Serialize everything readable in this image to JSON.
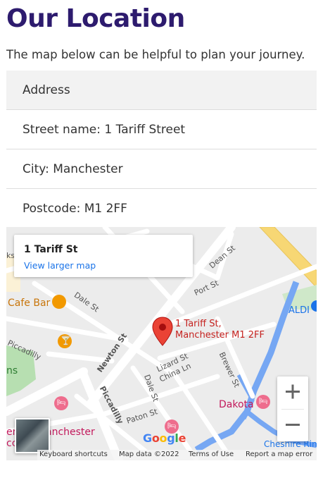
{
  "title": "Our Location",
  "intro": "The map below can be helpful to plan your journey.",
  "address_table": {
    "header": "Address",
    "rows": [
      "Street name: 1 Tariff Street",
      "City: Manchester",
      "Postcode: M1 2FF"
    ]
  },
  "map": {
    "card": {
      "place": "1 Tariff St",
      "link": "View larger map"
    },
    "pin_label_line1": "1 Tariff St,",
    "pin_label_line2": "Manchester M1 2FF",
    "streets": {
      "dean": "Dean St",
      "port": "Port St",
      "dale1": "Dale St",
      "dale2": "Dale St",
      "newton": "Newton St",
      "lizard": "Lizard St",
      "china": "China Ln",
      "brewer": "Brewer St",
      "paton": "Paton St",
      "piccadilly": "Piccadilly",
      "piccadilly_edge": "Piccadilly",
      "ks": "ks"
    },
    "pois": {
      "cafe_bar": "Cafe Bar",
      "aldi": "ALDI",
      "dakota": "Dakota",
      "cheshire": "Cheshire Rin",
      "ans": "ns",
      "manchester_left": "anchester",
      "cc": "cc",
      "ere": "ere"
    },
    "zoom_in": "+",
    "zoom_out": "−",
    "google": "Google",
    "attribution": {
      "shortcuts": "Keyboard shortcuts",
      "mapdata": "Map data ©2022",
      "terms": "Terms of Use",
      "report": "Report a map error"
    }
  },
  "colors": {
    "title": "#2d1b6e",
    "link": "#1a73e8",
    "pin": "#ea4335",
    "water": "#76a7f3",
    "park": "#b7dfb1",
    "highway": "#f7d774"
  }
}
